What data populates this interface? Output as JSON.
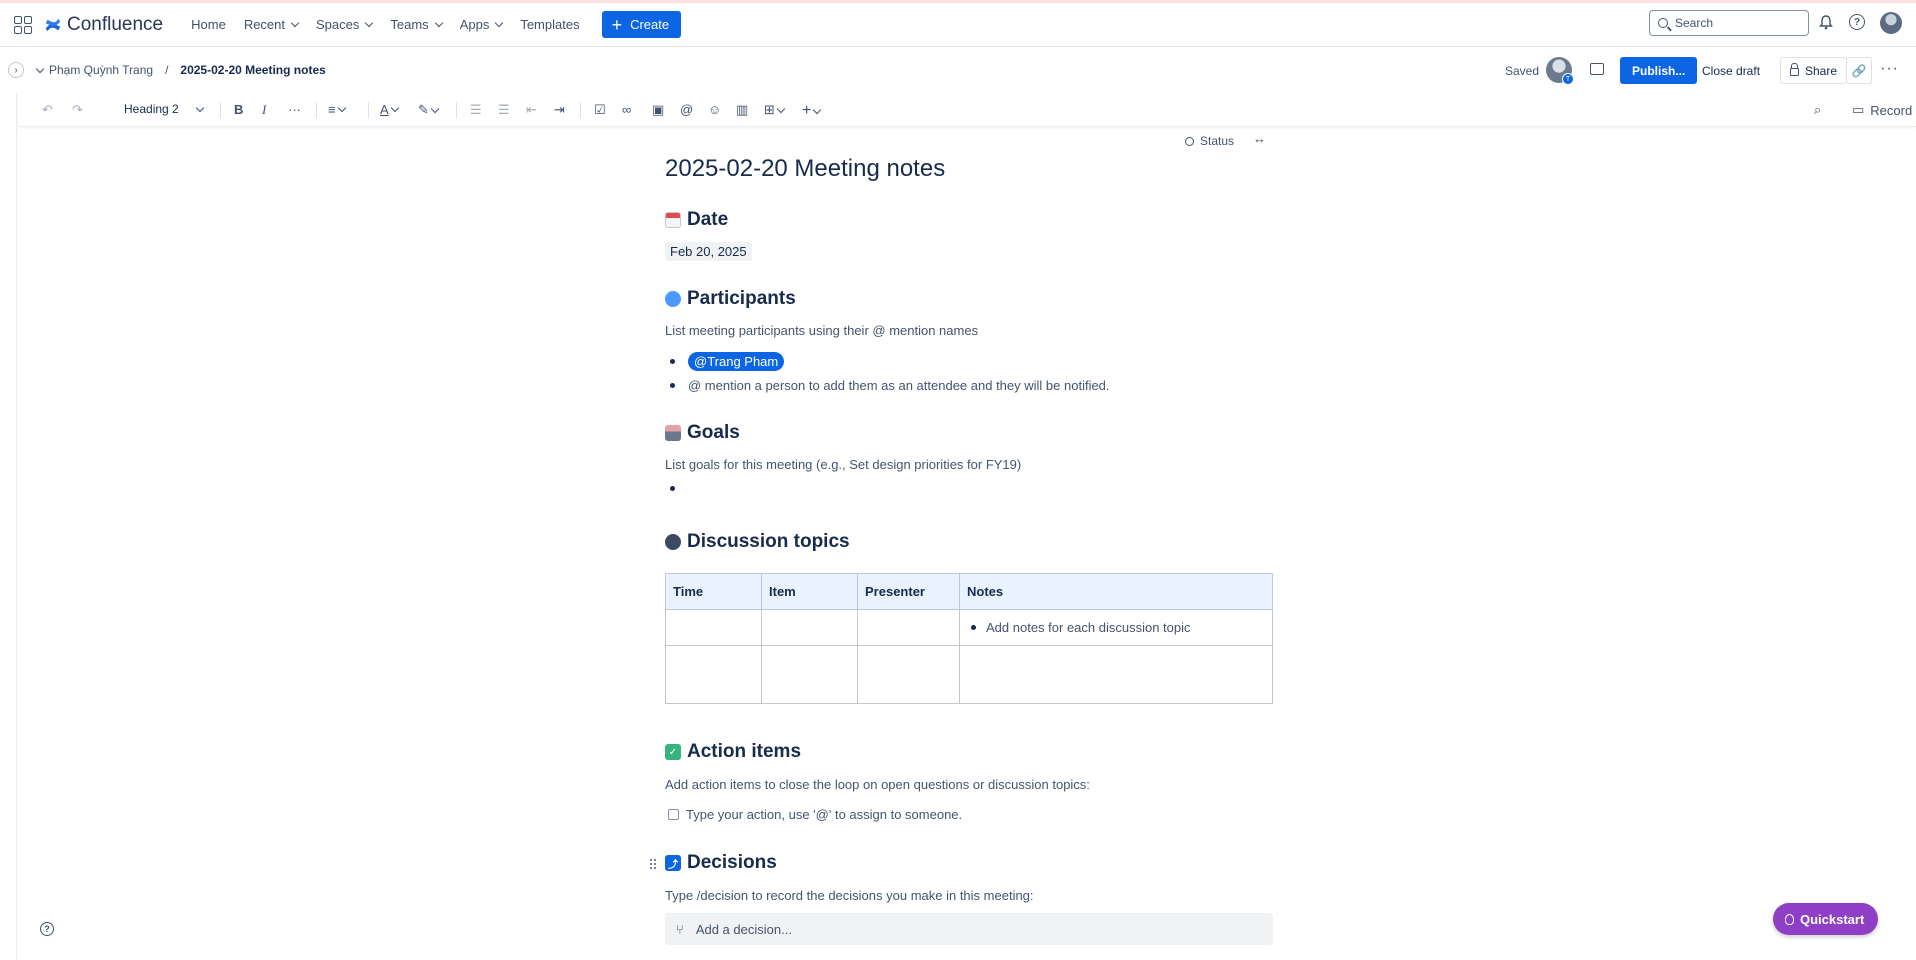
{
  "topnav": {
    "logo": "Confluence",
    "items": [
      "Home",
      "Recent",
      "Spaces",
      "Teams",
      "Apps",
      "Templates"
    ],
    "create_label": "Create",
    "search_placeholder": "Search"
  },
  "breadcrumb": {
    "space": "Phạm Quỳnh Trang",
    "separator": "/",
    "page": "2025-02-20 Meeting notes"
  },
  "actions": {
    "saved": "Saved",
    "avatar_badge": "T",
    "publish": "Publish...",
    "close_draft": "Close draft",
    "share": "Share"
  },
  "toolbar": {
    "text_style": "Heading 2",
    "record": "Record"
  },
  "page": {
    "status": "Status",
    "title": "2025-02-20 Meeting notes",
    "date_heading": "Date",
    "date_value": "Feb 20, 2025",
    "participants_heading": "Participants",
    "participants_hint": "List meeting participants using their @ mention names",
    "participants": [
      "@Trang Pham",
      "@ mention a person to add them as an attendee and they will be notified."
    ],
    "goals_heading": "Goals",
    "goals_hint": "List goals for this meeting (e.g., Set design priorities for FY19)",
    "discussion_heading": "Discussion topics",
    "table": {
      "headers": [
        "Time",
        "Item",
        "Presenter",
        "Notes"
      ],
      "note_placeholder": "Add notes for each discussion topic"
    },
    "actions_heading": "Action items",
    "actions_hint": "Add action items to close the loop on open questions or discussion topics:",
    "task_placeholder": "Type your action, use '@' to assign to someone.",
    "decisions_heading": "Decisions",
    "decisions_hint": "Type /decision to record the decisions you make in this meeting:",
    "decision_placeholder": "Add a decision..."
  },
  "quickstart": "Quickstart",
  "colors": {
    "primary": "#0c66e4",
    "quickstart": "#8f3fc6",
    "table_header": "#e9f2ff"
  }
}
